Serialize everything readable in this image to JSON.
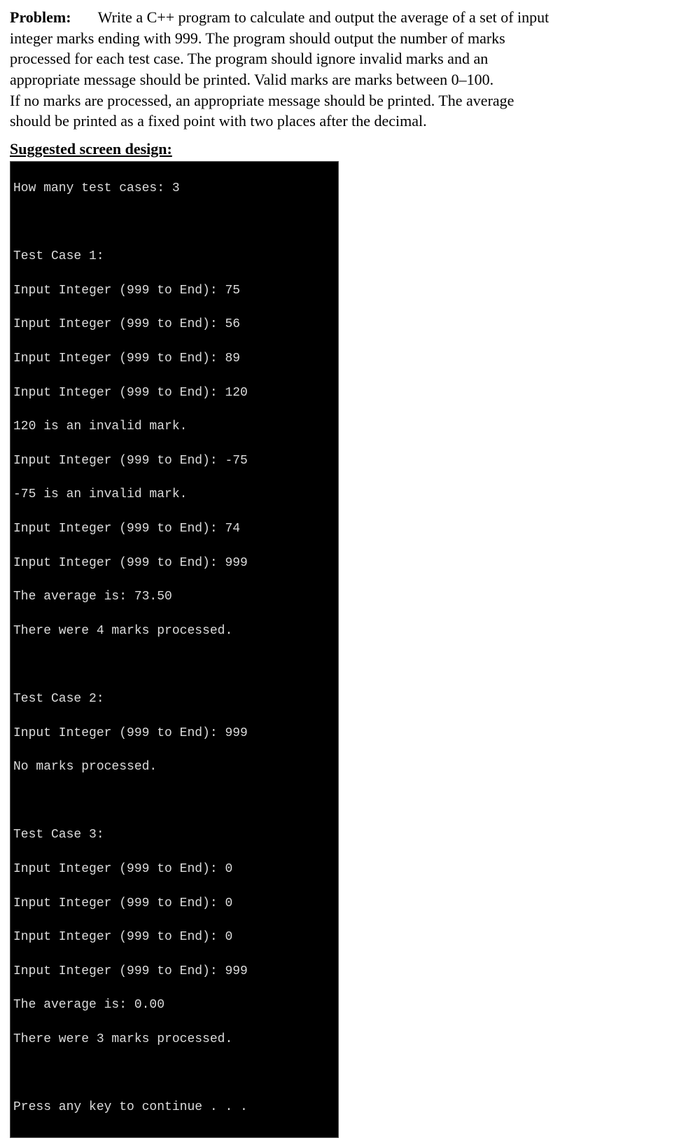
{
  "problem": {
    "label": "Problem:",
    "text_l1a": "Write a C++ program to calculate and output the average of a set of input",
    "text_l2": "integer marks ending with 999.  The program should output the number of marks",
    "text_l3": "processed for each test case.  The program should ignore invalid marks and an",
    "text_l4": "appropriate message should be printed.  Valid marks are marks between 0–100.",
    "text_l5": "If no marks are processed, an appropriate message should be printed.  The average",
    "text_l6": "should be printed as a fixed point with two places after the decimal."
  },
  "suggested_label": "Suggested screen design:",
  "terminal": {
    "lines": [
      "How many test cases: 3",
      "",
      "Test Case 1:",
      "Input Integer (999 to End): 75",
      "Input Integer (999 to End): 56",
      "Input Integer (999 to End): 89",
      "Input Integer (999 to End): 120",
      "120 is an invalid mark.",
      "Input Integer (999 to End): -75",
      "-75 is an invalid mark.",
      "Input Integer (999 to End): 74",
      "Input Integer (999 to End): 999",
      "The average is: 73.50",
      "There were 4 marks processed.",
      "",
      "Test Case 2:",
      "Input Integer (999 to End): 999",
      "No marks processed.",
      "",
      "Test Case 3:",
      "Input Integer (999 to End): 0",
      "Input Integer (999 to End): 0",
      "Input Integer (999 to End): 0",
      "Input Integer (999 to End): 999",
      "The average is: 0.00",
      "There were 3 marks processed.",
      "",
      "Press any key to continue . . ."
    ]
  }
}
